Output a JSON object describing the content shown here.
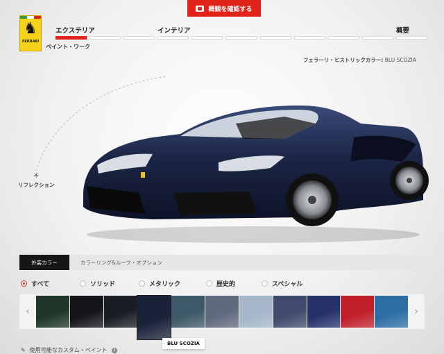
{
  "header": {
    "view_summary_label": "概観を確認する",
    "steps": [
      {
        "label": "エクステリア"
      },
      {
        "label": "インテリア"
      },
      {
        "label": "概要"
      }
    ],
    "subtitle": "ペイント・ワーク",
    "progress": {
      "segments": 11,
      "active_index": 0
    }
  },
  "logo": {
    "text": "FERRARI"
  },
  "selection": {
    "label": "フェラーリ・ヒストリックカラー:",
    "value": "BLU SCOZIA"
  },
  "reflection": {
    "label": "リフレクション"
  },
  "tabs": [
    {
      "label": "外装カラー",
      "active": true
    },
    {
      "label": "カラーリング&ルーフ・オプション",
      "active": false
    }
  ],
  "filters": [
    {
      "label": "すべて",
      "selected": true
    },
    {
      "label": "ソリッド",
      "selected": false
    },
    {
      "label": "メタリック",
      "selected": false
    },
    {
      "label": "歴史的",
      "selected": false
    },
    {
      "label": "スペシャル",
      "selected": false
    }
  ],
  "swatches": {
    "selected_index": 3,
    "colors": [
      "#1f3527",
      "#141518",
      "#1a1d24",
      "#1a2238",
      "#3d5866",
      "#606a7e",
      "#a4b6c8",
      "#404a6c",
      "#26326b",
      "#c0202a",
      "#2d6fa4"
    ]
  },
  "tooltip": {
    "text": "BLU SCOZIA"
  },
  "custom_paint": {
    "label": "使用可能なカスタム・ペイント"
  },
  "accent_color": "#e2231a"
}
